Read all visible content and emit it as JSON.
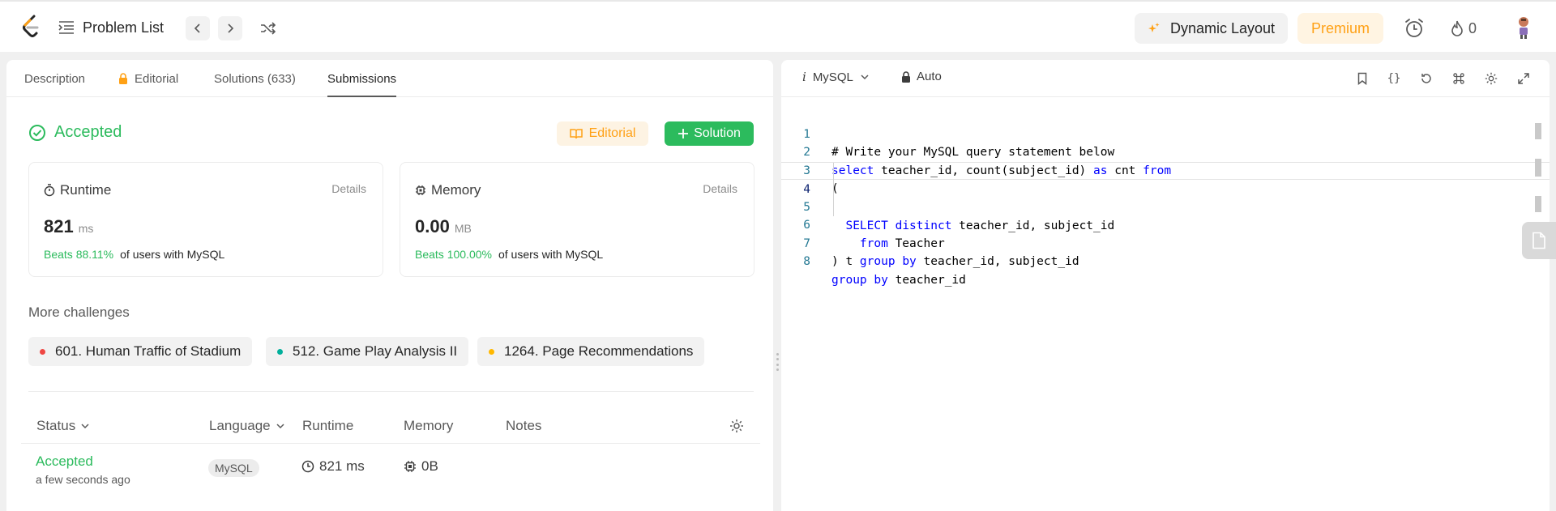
{
  "topbar": {
    "problem_list_label": "Problem List",
    "dynamic_layout_label": "Dynamic Layout",
    "premium_label": "Premium",
    "streak_count": "0"
  },
  "left": {
    "tabs": [
      {
        "label": "Description"
      },
      {
        "label": "Editorial"
      },
      {
        "label": "Solutions (633)"
      },
      {
        "label": "Submissions"
      }
    ],
    "result": {
      "status": "Accepted",
      "editorial_button": "Editorial",
      "solution_button": "Solution"
    },
    "runtime": {
      "label": "Runtime",
      "details": "Details",
      "value": "821",
      "unit": "ms",
      "beats": "Beats 88.11%",
      "beats_suffix": "of users with MySQL"
    },
    "memory": {
      "label": "Memory",
      "details": "Details",
      "value": "0.00",
      "unit": "MB",
      "beats": "Beats 100.00%",
      "beats_suffix": "of users with MySQL"
    },
    "more_challenges": {
      "title": "More challenges",
      "items": [
        {
          "label": "601. Human Traffic of Stadium",
          "color": "#ef4743"
        },
        {
          "label": "512. Game Play Analysis II",
          "color": "#00af9b"
        },
        {
          "label": "1264. Page Recommendations",
          "color": "#ffb800"
        }
      ]
    },
    "submissions_table": {
      "headers": [
        "Status",
        "Language",
        "Runtime",
        "Memory",
        "Notes"
      ],
      "rows": [
        {
          "status": "Accepted",
          "time": "a few seconds ago",
          "language": "MySQL",
          "runtime": "821 ms",
          "memory": "0B"
        }
      ]
    }
  },
  "editor": {
    "language": "MySQL",
    "mode": "Auto",
    "code_lines": [
      "# Write your MySQL query statement below",
      "select teacher_id, count(subject_id) as cnt from",
      "(",
      "  SELECT distinct teacher_id, subject_id",
      "    from Teacher",
      "    group by teacher_id, subject_id",
      ") t",
      "group by teacher_id"
    ],
    "line_numbers": [
      "1",
      "2",
      "3",
      "4",
      "5",
      "6",
      "7",
      "8"
    ]
  },
  "colors": {
    "accent_green": "#2cbb5d",
    "accent_orange": "#ffa116"
  }
}
